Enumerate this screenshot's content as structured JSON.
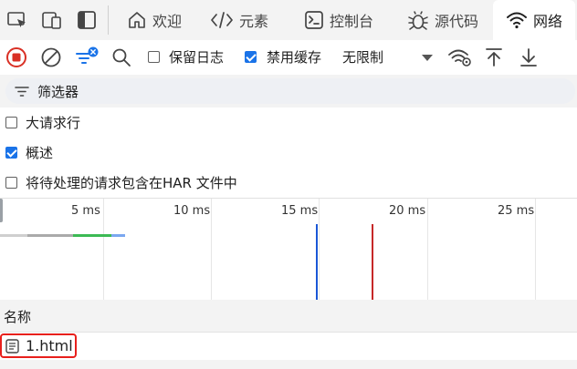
{
  "tabs": [
    {
      "label": "欢迎",
      "icon": "home-icon"
    },
    {
      "label": "元素",
      "icon": "code-icon"
    },
    {
      "label": "控制台",
      "icon": "console-icon"
    },
    {
      "label": "源代码",
      "icon": "bug-icon"
    },
    {
      "label": "网络",
      "icon": "wifi-icon",
      "active": true
    }
  ],
  "toolbar": {
    "preserve_log_label": "保留日志",
    "preserve_log_checked": false,
    "disable_cache_label": "禁用缓存",
    "disable_cache_checked": true,
    "throttle_value": "无限制"
  },
  "filter": {
    "label": "筛选器"
  },
  "options": [
    {
      "label": "大请求行",
      "checked": false
    },
    {
      "label": "概述",
      "checked": true
    },
    {
      "label": "将待处理的请求包含在HAR 文件中",
      "checked": false
    }
  ],
  "timeline": {
    "ticks": [
      "5 ms",
      "10 ms",
      "15 ms",
      "20 ms",
      "25 ms"
    ],
    "colors": {
      "dom_content_loaded": "#1a56d6",
      "load": "#c62828",
      "waiting": "#aaaaaa",
      "download": "#3cba54",
      "request": "#7aa7f0"
    }
  },
  "table": {
    "header": "名称",
    "rows": [
      {
        "name": "1.html",
        "icon": "document-icon"
      }
    ]
  },
  "colors": {
    "accent": "#1a73e8",
    "record_red": "#d93025",
    "highlight_red": "#e8201c"
  }
}
